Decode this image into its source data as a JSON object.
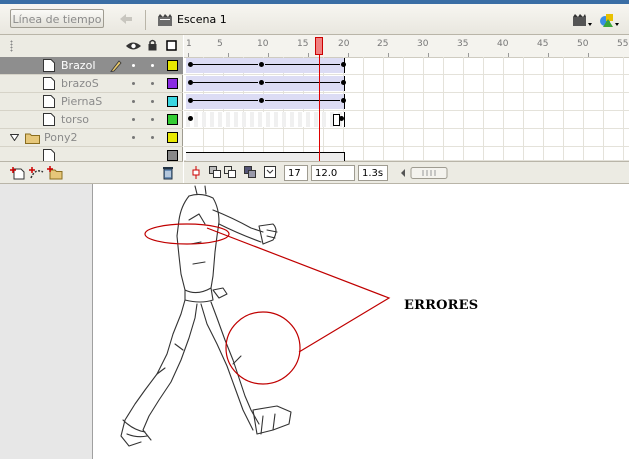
{
  "toolbar": {
    "timeline_button": "Línea de tiempo",
    "scene_label": "Escena 1",
    "icons": [
      "back-arrow-icon",
      "scene-icon",
      "edit-scene-icon",
      "edit-symbols-icon"
    ]
  },
  "layers": {
    "header_icons": [
      "eye-icon",
      "lock-icon",
      "outline-icon"
    ],
    "items": [
      {
        "name": "BrazoI",
        "selected": true,
        "color": "#e8e800",
        "type": "layer",
        "pencil": true
      },
      {
        "name": "brazoS",
        "selected": false,
        "color": "#8a2be2",
        "type": "layer"
      },
      {
        "name": "PiernaS",
        "selected": false,
        "color": "#3ad6e0",
        "type": "layer"
      },
      {
        "name": "torso",
        "selected": false,
        "color": "#33cc33",
        "type": "layer"
      },
      {
        "name": "Pony2",
        "selected": false,
        "color": "#e8e800",
        "type": "folder",
        "expanded": true
      }
    ],
    "footer_icons": [
      "add-layer-icon",
      "add-guide-icon",
      "add-folder-icon",
      "trash-icon"
    ]
  },
  "timeline": {
    "ruler_numbers": [
      "1",
      "5",
      "10",
      "15",
      "20",
      "25",
      "30",
      "35",
      "40",
      "45",
      "50",
      "55"
    ],
    "current_frame": "17",
    "frame_rate": "12.0 fps",
    "elapsed_time": "1.3s"
  },
  "stage": {
    "annotation_text": "ERRORES"
  },
  "colors": {
    "annotation": "#c00000",
    "selected_layer": "#8e8e8e",
    "playhead": "#d00000"
  }
}
